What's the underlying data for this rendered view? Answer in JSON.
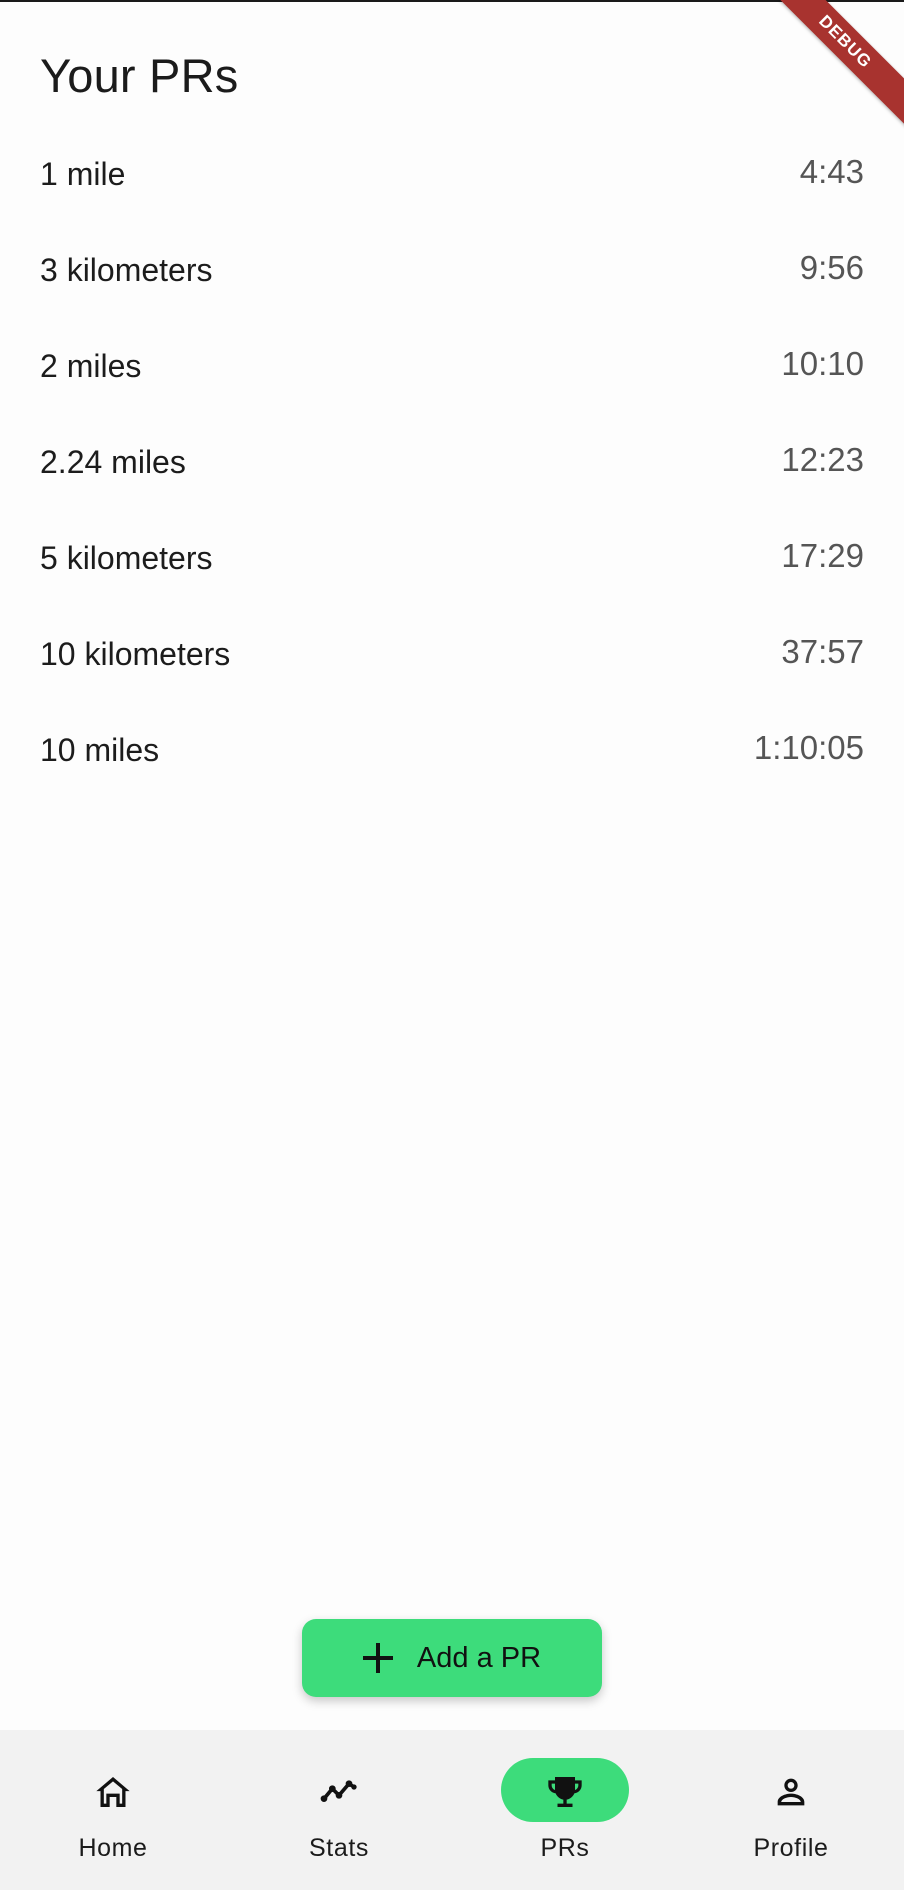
{
  "page": {
    "title": "Your PRs",
    "debug_banner": "DEBUG"
  },
  "prs": [
    {
      "distance": "1 mile",
      "time": "4:43"
    },
    {
      "distance": "3 kilometers",
      "time": "9:56"
    },
    {
      "distance": "2 miles",
      "time": "10:10"
    },
    {
      "distance": "2.24 miles",
      "time": "12:23"
    },
    {
      "distance": "5 kilometers",
      "time": "17:29"
    },
    {
      "distance": "10 kilometers",
      "time": "37:57"
    },
    {
      "distance": "10 miles",
      "time": "1:10:05"
    }
  ],
  "fab": {
    "label": "Add a PR",
    "icon": "plus-icon"
  },
  "nav": {
    "items": [
      {
        "label": "Home",
        "icon": "home-icon",
        "active": false
      },
      {
        "label": "Stats",
        "icon": "stats-line-icon",
        "active": false
      },
      {
        "label": "PRs",
        "icon": "trophy-icon",
        "active": true
      },
      {
        "label": "Profile",
        "icon": "person-icon",
        "active": false
      }
    ]
  },
  "colors": {
    "accent": "#3ddc7b",
    "nav_background": "#f2f2f2",
    "time_text": "#555555",
    "debug_ribbon": "#a8332f"
  }
}
